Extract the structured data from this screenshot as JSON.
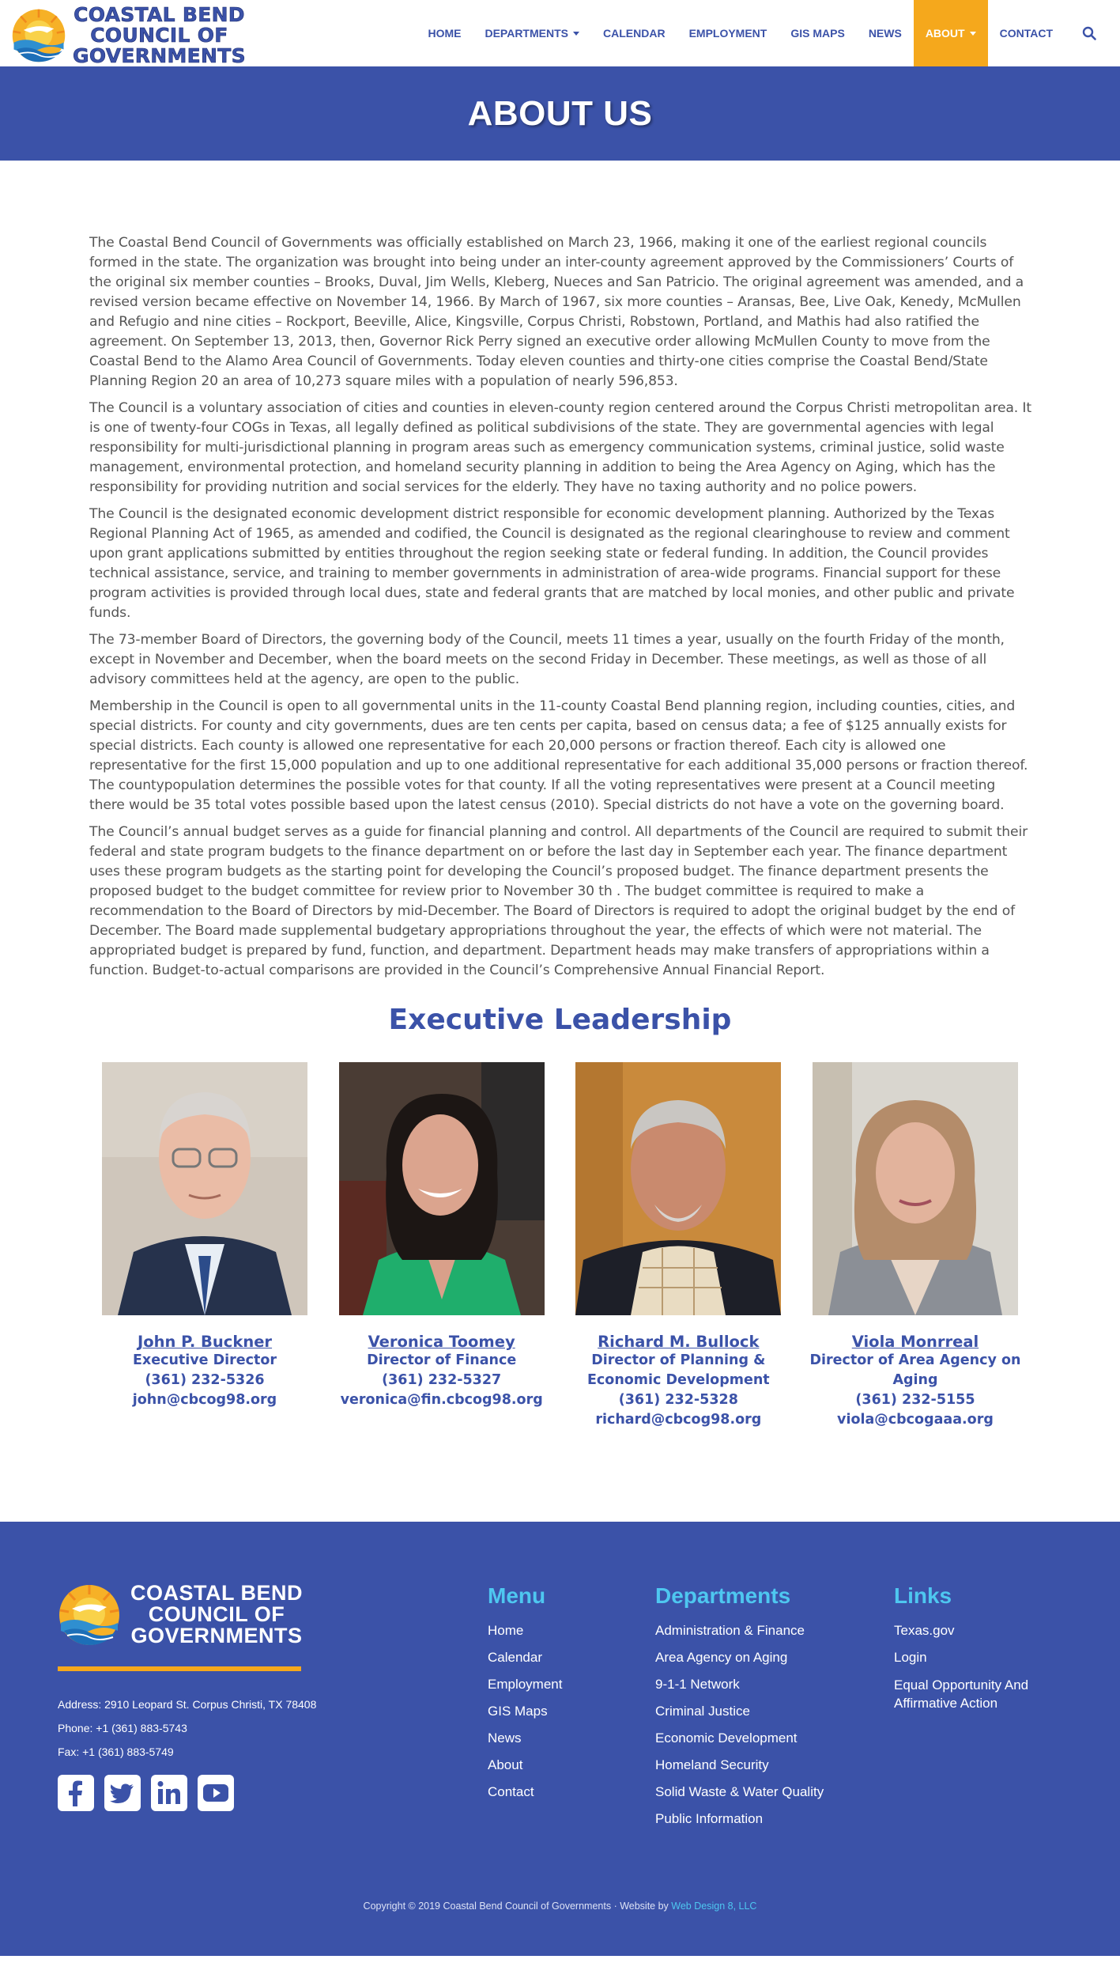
{
  "site": {
    "logo_lines": [
      "COASTAL BEND",
      "COUNCIL OF",
      "GOVERNMENTS"
    ]
  },
  "nav": {
    "items": [
      {
        "label": "HOME"
      },
      {
        "label": "DEPARTMENTS",
        "has_dropdown": true
      },
      {
        "label": "CALENDAR"
      },
      {
        "label": "EMPLOYMENT"
      },
      {
        "label": "GIS MAPS"
      },
      {
        "label": "NEWS"
      },
      {
        "label": "ABOUT",
        "has_dropdown": true,
        "active": true
      },
      {
        "label": "CONTACT"
      }
    ],
    "search_icon": "search-icon"
  },
  "banner": {
    "title": "ABOUT US"
  },
  "about": {
    "paragraphs": [
      "The Coastal Bend Council of Governments was officially established on March 23, 1966, making it one of the earliest regional councils formed in the state. The organization was brought into being under an inter-county agreement approved by the Commissioners’ Courts of the original six member counties – Brooks, Duval, Jim Wells, Kleberg, Nueces and San Patricio. The original agreement was amended, and a revised version became effective on November 14, 1966. By March of 1967, six more counties – Aransas, Bee, Live Oak, Kenedy, McMullen and Refugio and nine cities – Rockport, Beeville, Alice, Kingsville, Corpus Christi, Robstown, Portland, and Mathis had also ratified the agreement. On September 13, 2013, then, Governor Rick Perry signed an executive order allowing McMullen County to move from the Coastal Bend to the Alamo Area Council of Governments. Today eleven counties and thirty-one cities comprise the Coastal Bend/State Planning Region 20 an area of 10,273 square miles with a population of nearly 596,853.",
      "The Council is a voluntary association of cities and counties in eleven-county region centered around the Corpus Christi metropolitan area. It is one of twenty-four COGs in Texas, all legally defined as political subdivisions of the state. They are governmental agencies with legal responsibility for multi-jurisdictional planning in program areas such as emergency communication systems, criminal justice, solid waste management, environmental protection, and homeland security planning in addition to being the Area Agency on Aging, which has the responsibility for providing nutrition and social services for the elderly. They have no taxing authority and no police powers.",
      "The Council is the designated economic development district responsible for economic development planning. Authorized by the Texas Regional Planning Act of 1965, as amended and codified, the Council is designated as the regional clearinghouse to review and comment upon grant applications submitted by entities throughout the region seeking state or federal funding. In addition, the Council provides technical assistance, service, and training to member governments in administration of area-wide programs. Financial support for these program activities is provided through local dues, state and federal grants that are matched by local monies, and other public and private funds.",
      "The 73-member Board of Directors, the governing body of the Council, meets 11 times a year, usually on the fourth Friday of the month, except in November and December, when the board meets on the second Friday in December. These meetings, as well as those of all advisory committees held at the agency, are open to the public.",
      "Membership in the Council is open to all governmental units in the 11-county Coastal Bend planning region, including counties, cities, and special districts. For county and city governments, dues are ten cents per capita, based on census data; a fee of $125 annually exists for special districts. Each county is allowed one representative for each 20,000 persons or fraction thereof. Each city is allowed one representative for the first 15,000 population and up to one additional representative for each additional 35,000 persons or fraction thereof. The countypopulation determines the possible votes for that county. If all the voting representatives were present at a Council meeting there would be 35 total votes possible based upon the latest census (2010). Special districts do not have a vote on the governing board.",
      "The Council’s annual budget serves as a guide for financial planning and control. All departments of the Council are required to submit their federal and state program budgets to the finance department on or before the last day in September each year. The finance department uses these program budgets as the starting point for developing the Council’s proposed budget. The finance department presents the proposed budget to the budget committee for review prior to November 30 th . The budget committee is required to make a recommendation to the Board of Directors by mid-December. The Board of Directors is required to adopt the original budget by the end of December. The Board made supplemental budgetary appropriations throughout the year, the effects of which were not material. The appropriated budget is prepared by fund, function, and department. Department heads may make transfers of appropriations within a function. Budget-to-actual comparisons are provided in the Council’s Comprehensive Annual Financial Report."
    ]
  },
  "leadership": {
    "heading": "Executive Leadership",
    "members": [
      {
        "name": "John P. Buckner",
        "title": "Executive Director",
        "phone": "(361) 232-5326",
        "email": "john@cbcog98.org"
      },
      {
        "name": "Veronica Toomey",
        "title": "Director of Finance",
        "phone": "(361) 232-5327",
        "email": "veronica@fin.cbcog98.org"
      },
      {
        "name": "Richard M. Bullock",
        "title": "Director of Planning & Economic Development",
        "phone": "(361) 232-5328",
        "email": "richard@cbcog98.org"
      },
      {
        "name": "Viola Monrreal",
        "title": "Director of Area Agency on Aging",
        "phone": "(361) 232-5155",
        "email": "viola@cbcogaaa.org"
      }
    ]
  },
  "footer": {
    "address": "Address: 2910 Leopard St. Corpus Christi, TX 78408",
    "phone": "Phone: +1 (361) 883-5743",
    "fax": "Fax: +1 (361) 883-5749",
    "social_icons": [
      "facebook-icon",
      "twitter-icon",
      "linkedin-icon",
      "youtube-icon"
    ],
    "menu": {
      "heading": "Menu",
      "items": [
        "Home",
        "Calendar",
        "Employment",
        "GIS Maps",
        "News",
        "About",
        "Contact"
      ]
    },
    "departments": {
      "heading": "Departments",
      "items": [
        "Administration & Finance",
        "Area Agency on Aging",
        "9-1-1 Network",
        "Criminal Justice",
        "Economic Development",
        "Homeland Security",
        "Solid Waste & Water Quality",
        "Public Information"
      ]
    },
    "links": {
      "heading": "Links",
      "items": [
        "Texas.gov",
        "Login",
        "Equal Opportunity And Affirmative Action"
      ]
    },
    "copyright": "Copyright © 2019 Coastal Bend Council of Governments · Website by ",
    "credit": "Web Design 8, LLC"
  },
  "colors": {
    "brand_blue": "#3b52a8",
    "accent_orange": "#f5a81c",
    "footer_heading": "#4ec7f0"
  }
}
